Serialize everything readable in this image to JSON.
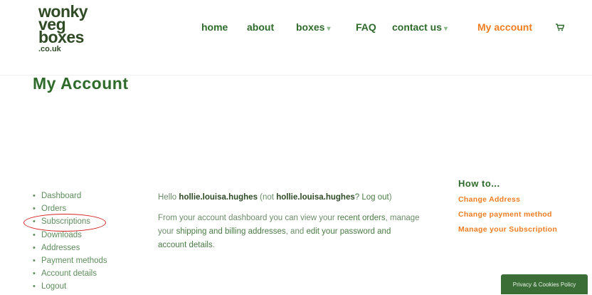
{
  "brand": {
    "logo_lines": [
      "wonky",
      "veg",
      "boxes",
      ".co.uk"
    ]
  },
  "nav": {
    "items": [
      {
        "label": "home",
        "has_caret": false
      },
      {
        "label": "about",
        "has_caret": false
      },
      {
        "label": "boxes",
        "has_caret": true
      },
      {
        "label": "FAQ",
        "has_caret": false
      },
      {
        "label": "contact us",
        "has_caret": true
      },
      {
        "label": "My account",
        "has_caret": false,
        "active": true
      }
    ],
    "cart_icon": "cart-icon"
  },
  "page": {
    "title": "My Account"
  },
  "account_nav": {
    "items": [
      "Dashboard",
      "Orders",
      "Subscriptions",
      "Downloads",
      "Addresses",
      "Payment methods",
      "Account details",
      "Logout"
    ],
    "highlighted": "Subscriptions"
  },
  "content": {
    "hello_prefix": "Hello",
    "username": "hollie.louisa.hughes",
    "not_prefix": "(not",
    "username_again": "hollie.louisa.hughes",
    "logout_link": "? Log out",
    "close_paren": ")",
    "p2_part1": "From your account dashboard you can view your",
    "recent_orders_link": "recent orders",
    "p2_part2": ", manage your",
    "addresses_link": "shipping and billing addresses",
    "p2_part3": ", and",
    "account_details_link": "edit your password and account details",
    "p2_end": "."
  },
  "howto": {
    "title": "How to...",
    "links": [
      "Change Address",
      "Change payment method",
      "Manage your Subscription"
    ]
  },
  "privacy": {
    "label": "Privacy & Cookies Policy"
  },
  "colors": {
    "brand_green": "#2e6b2b",
    "accent_orange": "#f07d22",
    "highlight_red": "#d42222",
    "privacy_bg": "#3b6d36"
  }
}
